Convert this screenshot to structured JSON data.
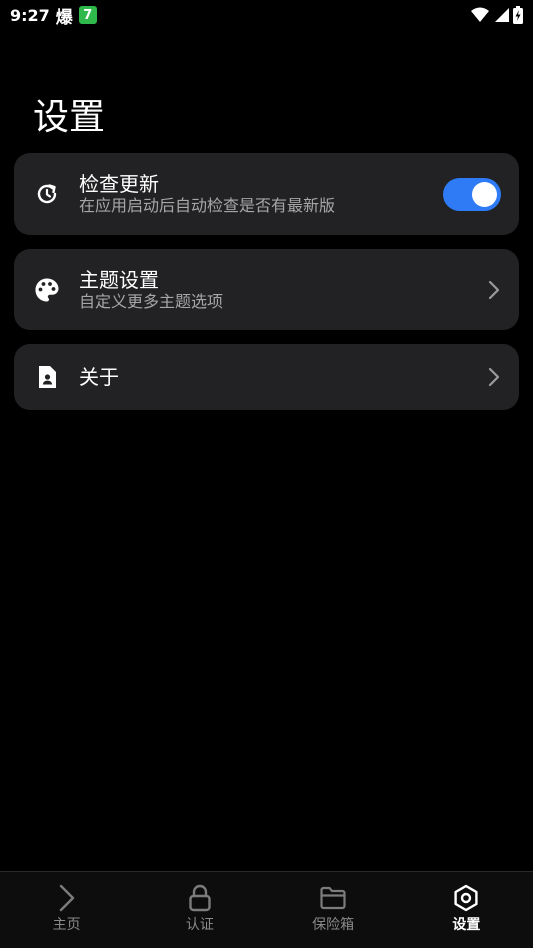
{
  "status_bar": {
    "time": "9:27",
    "app_glyph": "爆",
    "badge_text": "7",
    "icons": [
      "wifi-icon",
      "signal-icon",
      "battery-charging-icon"
    ]
  },
  "page": {
    "title": "设置"
  },
  "settings": {
    "check_update": {
      "title": "检查更新",
      "subtitle": "在应用启动后自动检查是否有最新版",
      "icon": "update-icon",
      "enabled": true
    },
    "theme": {
      "title": "主题设置",
      "subtitle": "自定义更多主题选项",
      "icon": "palette-icon"
    },
    "about": {
      "title": "关于",
      "icon": "contact-document-icon"
    }
  },
  "bottom_nav": {
    "items": [
      {
        "label": "主页",
        "icon": "chevron-right-icon",
        "active": false
      },
      {
        "label": "认证",
        "icon": "lock-icon",
        "active": false
      },
      {
        "label": "保险箱",
        "icon": "folder-icon",
        "active": false
      },
      {
        "label": "设置",
        "icon": "hexagon-settings-icon",
        "active": true
      }
    ]
  },
  "colors": {
    "background": "#000000",
    "card": "#222224",
    "accent": "#2f7bf5",
    "secondary_text": "#a6a6a8"
  }
}
